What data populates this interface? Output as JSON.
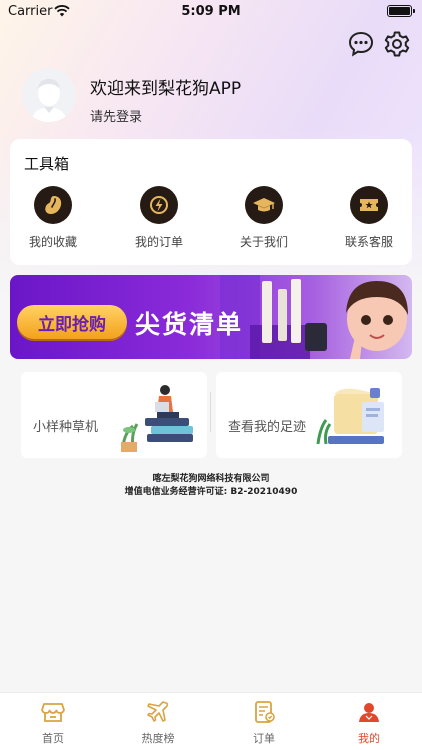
{
  "status_bar": {
    "carrier": "Carrier",
    "time": "5:09 PM"
  },
  "header": {
    "welcome": "欢迎来到梨花狗APP",
    "login_prompt": "请先登录"
  },
  "toolbox": {
    "title": "工具箱",
    "items": [
      {
        "label": "我的收藏",
        "icon": "bean-icon"
      },
      {
        "label": "我的订单",
        "icon": "lightning-icon"
      },
      {
        "label": "关于我们",
        "icon": "graduation-cap-icon"
      },
      {
        "label": "联系客服",
        "icon": "ticket-icon"
      }
    ]
  },
  "banner": {
    "button": "立即抢购",
    "title": "尖货清单"
  },
  "promos": {
    "left": "小样种草机",
    "right": "查看我的足迹"
  },
  "footer": {
    "company": "喀左梨花狗网络科技有限公司",
    "license": "增值电信业务经营许可证:  B2-20210490"
  },
  "tabs": [
    {
      "label": "首页",
      "icon": "shop-icon"
    },
    {
      "label": "热度榜",
      "icon": "airplane-icon"
    },
    {
      "label": "订单",
      "icon": "order-list-icon"
    },
    {
      "label": "我的",
      "icon": "profile-icon",
      "active": true
    }
  ],
  "colors": {
    "accent": "#e0482b",
    "gold": "#d9a441",
    "tool_bg": "#261a14",
    "banner": "#7a22d0"
  }
}
